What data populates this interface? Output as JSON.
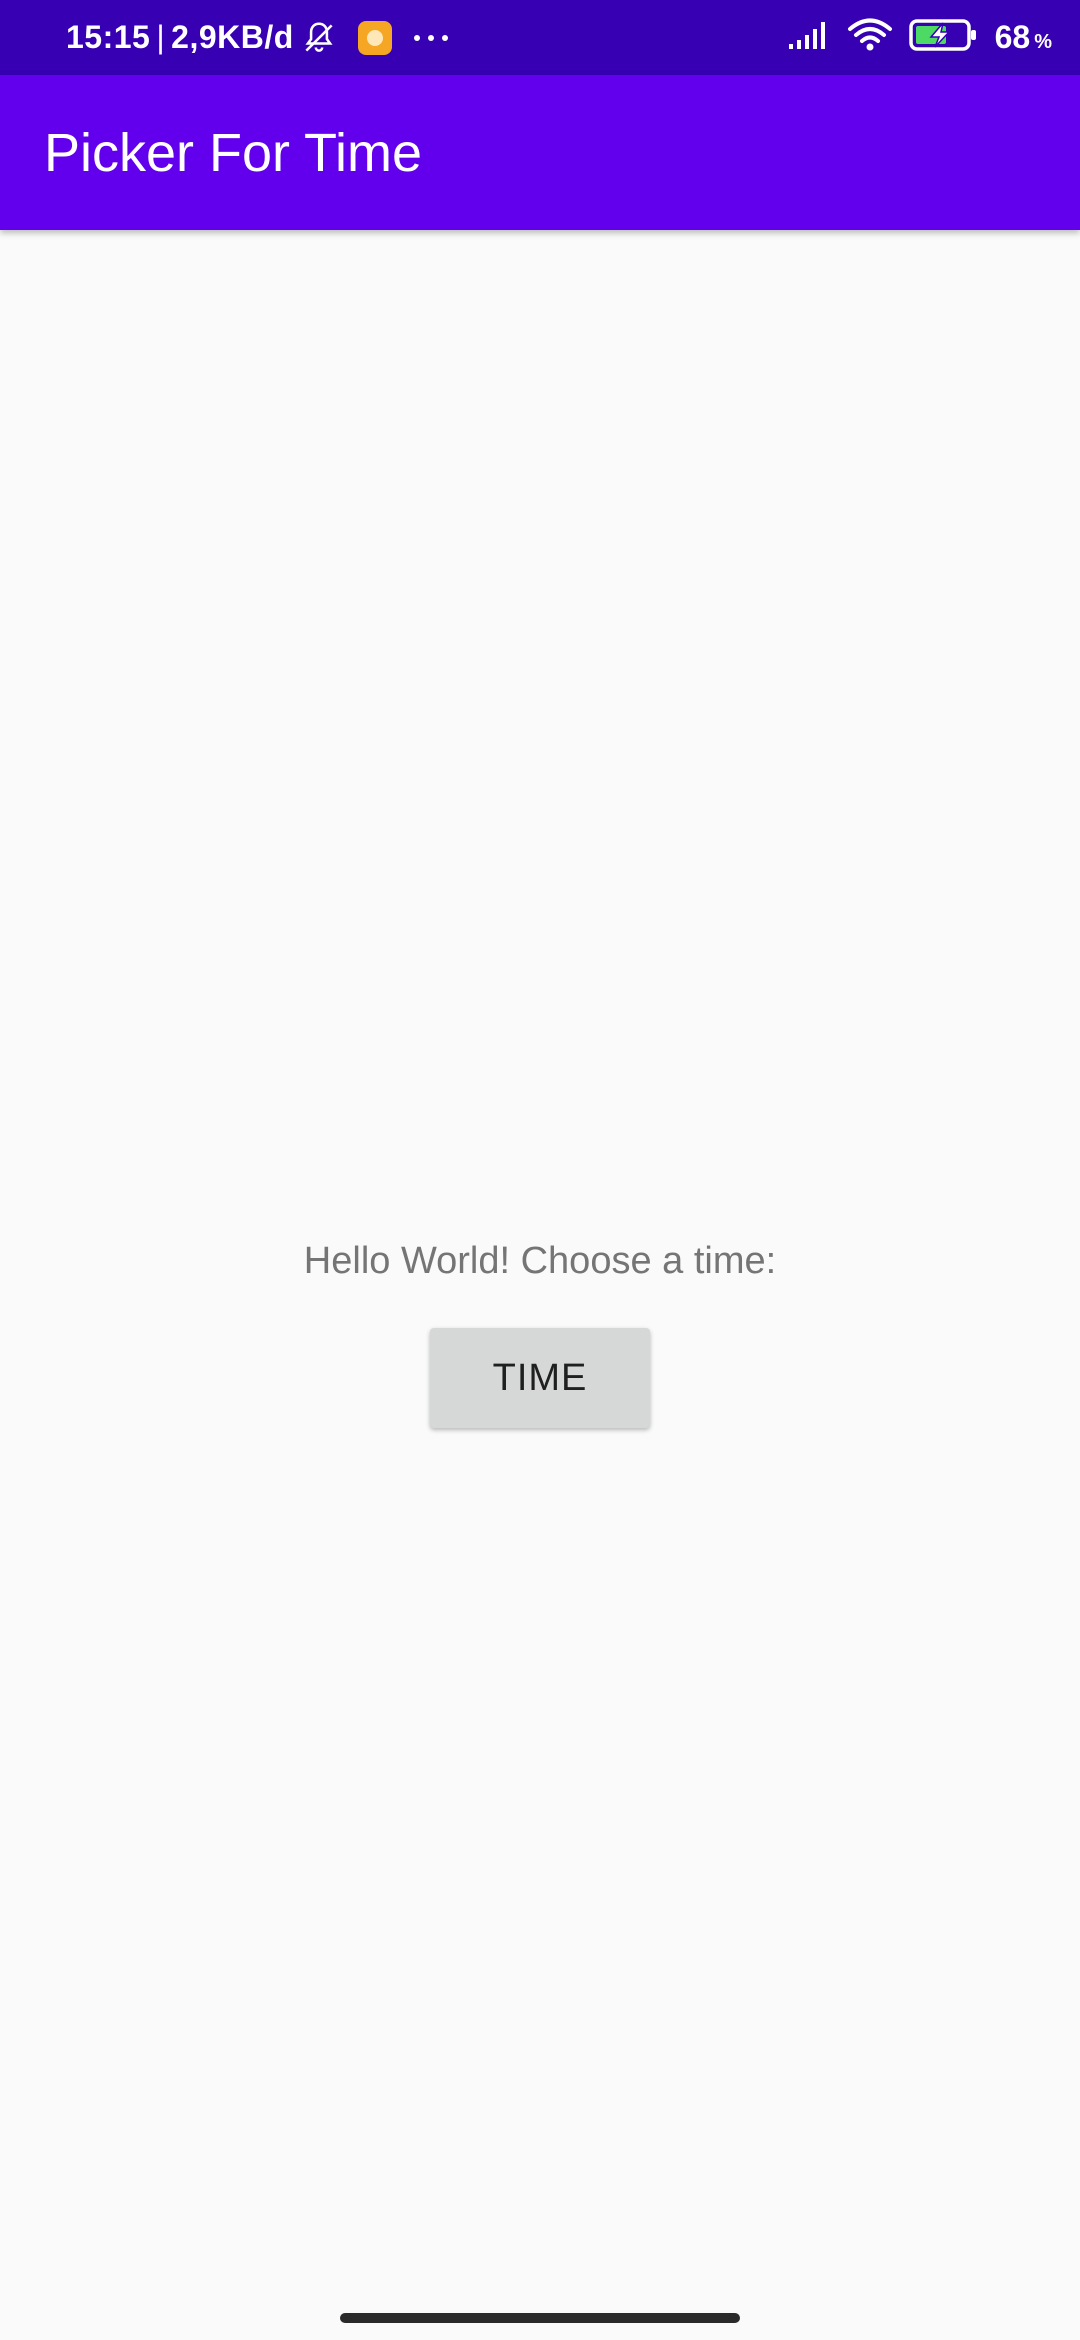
{
  "status_bar": {
    "time": "15:15",
    "separator": "|",
    "data_rate": "2,9KB/d",
    "battery_level": "68",
    "battery_unit": "%",
    "icons": [
      "muted-bell-icon",
      "app-notification-icon",
      "more-dots-icon",
      "signal-icon",
      "wifi-icon",
      "battery-charging-icon"
    ]
  },
  "app_bar": {
    "title": "Picker For Time"
  },
  "main": {
    "prompt": "Hello World! Choose a time:",
    "time_button_label": "TIME"
  },
  "colors": {
    "status_bar": "#3700b3",
    "app_bar": "#6200ee",
    "background": "#fafafa",
    "button": "#d6d7d7",
    "battery_fill": "#4cd964"
  }
}
